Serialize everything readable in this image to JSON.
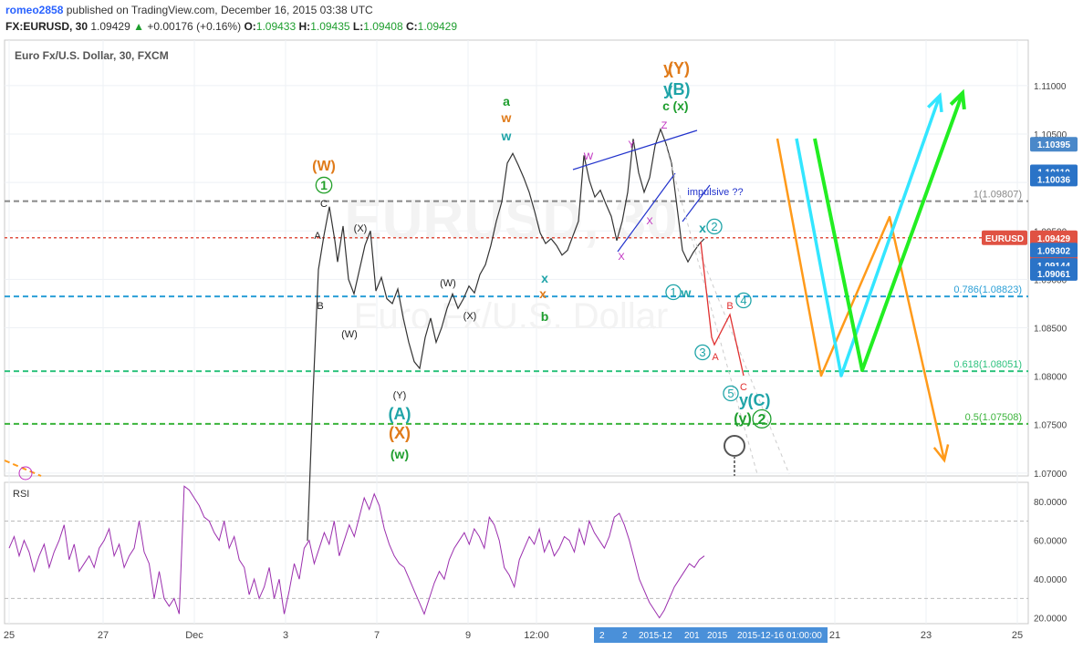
{
  "header": {
    "author": "romeo2858",
    "published": "published on TradingView.com, December 16, 2015 03:38 UTC",
    "symbol": "FX:EURUSD, 30",
    "last": "1.09429",
    "change": "+0.00176 (+0.16%)",
    "o_label": "O:",
    "o_value": "1.09433",
    "h_label": "H:",
    "h_value": "1.09435",
    "l_label": "L:",
    "l_value": "1.09408",
    "c_label": "C:",
    "c_value": "1.09429"
  },
  "chart_data": {
    "type": "line",
    "title": "Euro Fx/U.S. Dollar, 30, FXCM",
    "watermark": "EURUSD, 30",
    "watermark_sub": "Euro Fx/U.S. Dollar",
    "price_axis": {
      "ticks": [
        "1.07000",
        "1.07500",
        "1.08000",
        "1.08500",
        "1.09000",
        "1.09500",
        "1.10000",
        "1.10500",
        "1.11000"
      ],
      "range": [
        1.0697,
        1.1147
      ],
      "flags": [
        {
          "label": "1.10395",
          "value": 1.10395,
          "color": "#4a88c9"
        },
        {
          "label": "1.10110",
          "value": 1.1011,
          "color": "#2a73c7"
        },
        {
          "label": "1.10036",
          "value": 1.10036,
          "color": "#2a73c7"
        },
        {
          "label": "1.09429",
          "value": 1.09429,
          "color": "#e05243",
          "name": "EURUSD",
          "timer": "21:43"
        },
        {
          "label": "1.09302",
          "value": 1.09302,
          "color": "#2a73c7"
        },
        {
          "label": "1.09144",
          "value": 1.09144,
          "color": "#2a73c7"
        },
        {
          "label": "1.09061",
          "value": 1.09061,
          "color": "#2a73c7"
        }
      ]
    },
    "time_axis": {
      "ticks": [
        "25",
        "27",
        "Dec",
        "3",
        "7",
        "9",
        "12:00",
        "21",
        "23",
        "25"
      ],
      "crosshair_label": "2015-12-16 01:00:00",
      "clipped_labels": [
        "2",
        "2",
        "2015-12",
        "201",
        "2015"
      ]
    },
    "fib_levels": [
      {
        "label": "1(1.09807)",
        "value": 1.09807,
        "color": "#888888"
      },
      {
        "label": "0.786(1.08823)",
        "value": 1.08823,
        "color": "#2a9fd6"
      },
      {
        "label": "0.618(1.08051)",
        "value": 1.08051,
        "color": "#2ec27e"
      },
      {
        "label": "0.5(1.07508)",
        "value": 1.07508,
        "color": "#3cb43c"
      }
    ],
    "current_price_line": {
      "value": 1.09429,
      "color": "#e05243"
    },
    "price_path": [
      [
        1.063,
        -1
      ],
      [
        1.078,
        1
      ],
      [
        1.091,
        3
      ],
      [
        1.0945,
        5
      ],
      [
        1.0975,
        7
      ],
      [
        1.094,
        9
      ],
      [
        1.0918,
        10
      ],
      [
        1.0955,
        12
      ],
      [
        1.09,
        14
      ],
      [
        1.0885,
        16
      ],
      [
        1.091,
        18
      ],
      [
        1.0935,
        20
      ],
      [
        1.095,
        22
      ],
      [
        1.0888,
        24
      ],
      [
        1.0902,
        26
      ],
      [
        1.088,
        28
      ],
      [
        1.0875,
        30
      ],
      [
        1.089,
        32
      ],
      [
        1.086,
        34
      ],
      [
        1.0835,
        36
      ],
      [
        1.0815,
        38
      ],
      [
        1.0808,
        40
      ],
      [
        1.084,
        42
      ],
      [
        1.086,
        44
      ],
      [
        1.0835,
        46
      ],
      [
        1.085,
        48
      ],
      [
        1.087,
        50
      ],
      [
        1.0885,
        52
      ],
      [
        1.087,
        54
      ],
      [
        1.088,
        56
      ],
      [
        1.0893,
        58
      ],
      [
        1.0886,
        60
      ],
      [
        1.0905,
        62
      ],
      [
        1.0915,
        64
      ],
      [
        1.0935,
        66
      ],
      [
        1.096,
        68
      ],
      [
        1.098,
        70
      ],
      [
        1.102,
        72
      ],
      [
        1.103,
        74
      ],
      [
        1.1018,
        76
      ],
      [
        1.1005,
        78
      ],
      [
        1.099,
        80
      ],
      [
        1.097,
        82
      ],
      [
        1.0948,
        84
      ],
      [
        1.0937,
        86
      ],
      [
        1.0942,
        88
      ],
      [
        1.0935,
        90
      ],
      [
        1.0925,
        92
      ],
      [
        1.093,
        94
      ],
      [
        1.0945,
        96
      ],
      [
        1.096,
        98
      ],
      [
        1.1028,
        100
      ],
      [
        1.1002,
        102
      ],
      [
        1.0985,
        104
      ],
      [
        1.0992,
        106
      ],
      [
        1.0978,
        108
      ],
      [
        1.0965,
        110
      ],
      [
        1.094,
        112
      ],
      [
        1.096,
        114
      ],
      [
        1.099,
        116
      ],
      [
        1.1045,
        118
      ],
      [
        1.101,
        120
      ],
      [
        1.099,
        122
      ],
      [
        1.1005,
        124
      ],
      [
        1.1038,
        126
      ],
      [
        1.1055,
        128
      ],
      [
        1.104,
        130
      ],
      [
        1.102,
        132
      ],
      [
        1.0975,
        134
      ],
      [
        1.093,
        136
      ],
      [
        1.0918,
        138
      ],
      [
        1.0928,
        140
      ],
      [
        1.0936,
        142
      ],
      [
        1.0942,
        144
      ]
    ],
    "rsi": {
      "label": "RSI",
      "ticks": [
        "20.0000",
        "40.0000",
        "60.0000",
        "80.0000"
      ],
      "range": [
        17,
        90
      ],
      "bands": [
        30,
        70
      ],
      "values": [
        56,
        62,
        52,
        60,
        54,
        44,
        52,
        58,
        46,
        54,
        60,
        68,
        50,
        58,
        44,
        48,
        52,
        46,
        56,
        60,
        66,
        52,
        58,
        46,
        52,
        56,
        70,
        54,
        48,
        30,
        44,
        30,
        26,
        30,
        22,
        88,
        86,
        82,
        78,
        72,
        70,
        64,
        60,
        70,
        56,
        62,
        50,
        46,
        32,
        40,
        30,
        36,
        46,
        30,
        40,
        22,
        34,
        48,
        40,
        56,
        60,
        48,
        56,
        64,
        58,
        70,
        52,
        60,
        68,
        62,
        72,
        82,
        76,
        84,
        78,
        66,
        58,
        52,
        48,
        46,
        40,
        34,
        28,
        22,
        30,
        38,
        44,
        40,
        50,
        56,
        60,
        64,
        58,
        66,
        62,
        56,
        72,
        68,
        60,
        46,
        42,
        36,
        50,
        56,
        62,
        58,
        66,
        54,
        60,
        52,
        56,
        62,
        60,
        54,
        66,
        58,
        70,
        64,
        60,
        56,
        62,
        72,
        74,
        68,
        60,
        50,
        40,
        34,
        28,
        24,
        20,
        24,
        30,
        36,
        40,
        44,
        48,
        46,
        50,
        52
      ]
    },
    "wave_labels": [
      {
        "text": "(W)",
        "color": "#e07b1a"
      },
      {
        "text": "1",
        "color": "#23a02a",
        "circled": true
      },
      {
        "text": "C",
        "color": "#222"
      },
      {
        "text": "A",
        "color": "#222"
      },
      {
        "text": "B",
        "color": "#222"
      },
      {
        "text": "(X)",
        "color": "#222"
      },
      {
        "text": "(W)",
        "color": "#222"
      },
      {
        "text": "(Y)",
        "color": "#222"
      },
      {
        "text": "(W)",
        "color": "#222"
      },
      {
        "text": "(X)",
        "color": "#222"
      },
      {
        "text": "(A)",
        "color": "#1fa4a8"
      },
      {
        "text": "(X)",
        "color": "#e07b1a"
      },
      {
        "text": "(w)",
        "color": "#1e9e2e"
      },
      {
        "text": "a",
        "color": "#1e9e2e"
      },
      {
        "text": "w",
        "color": "#e07b1a"
      },
      {
        "text": "w",
        "color": "#1fa4a8"
      },
      {
        "text": "x",
        "color": "#1fa4a8"
      },
      {
        "text": "x",
        "color": "#e07b1a"
      },
      {
        "text": "b",
        "color": "#1e9e2e"
      },
      {
        "text": "y",
        "color": "#e07b1a"
      },
      {
        "text": "(Y)",
        "color": "#e07b1a"
      },
      {
        "text": "y",
        "color": "#1fa4a8"
      },
      {
        "text": "(B)",
        "color": "#1fa4a8"
      },
      {
        "text": "c",
        "color": "#1e9e2e"
      },
      {
        "text": "(x)",
        "color": "#1e9e2e"
      },
      {
        "text": "W",
        "color": "#c02fc0"
      },
      {
        "text": "Y",
        "color": "#c02fc0"
      },
      {
        "text": "Z",
        "color": "#c02fc0"
      },
      {
        "text": "X",
        "color": "#c02fc0"
      },
      {
        "text": "X",
        "color": "#c02fc0"
      },
      {
        "text": "x",
        "color": "#1fa4a8"
      },
      {
        "text": "2",
        "color": "#1fa4a8",
        "circled": true
      },
      {
        "text": "1",
        "color": "#1fa4a8",
        "circled": true
      },
      {
        "text": "w",
        "color": "#1fa4a8"
      },
      {
        "text": "impulsive ??",
        "color": "#2233cc"
      },
      {
        "text": "3",
        "color": "#1fa4a8",
        "circled": true
      },
      {
        "text": "A",
        "color": "#e03030"
      },
      {
        "text": "B",
        "color": "#e03030"
      },
      {
        "text": "4",
        "color": "#1fa4a8",
        "circled": true
      },
      {
        "text": "C",
        "color": "#e03030"
      },
      {
        "text": "5",
        "color": "#1fa4a8",
        "circled": true
      },
      {
        "text": "y",
        "color": "#1fa4a8"
      },
      {
        "text": "(C)",
        "color": "#1fa4a8"
      },
      {
        "text": "(y)",
        "color": "#1e9e2e"
      },
      {
        "text": "2",
        "color": "#1e9e2e",
        "circled": true
      }
    ],
    "projection_colors": [
      "#ff9a1a",
      "#33e6ff",
      "#22ee22"
    ]
  }
}
